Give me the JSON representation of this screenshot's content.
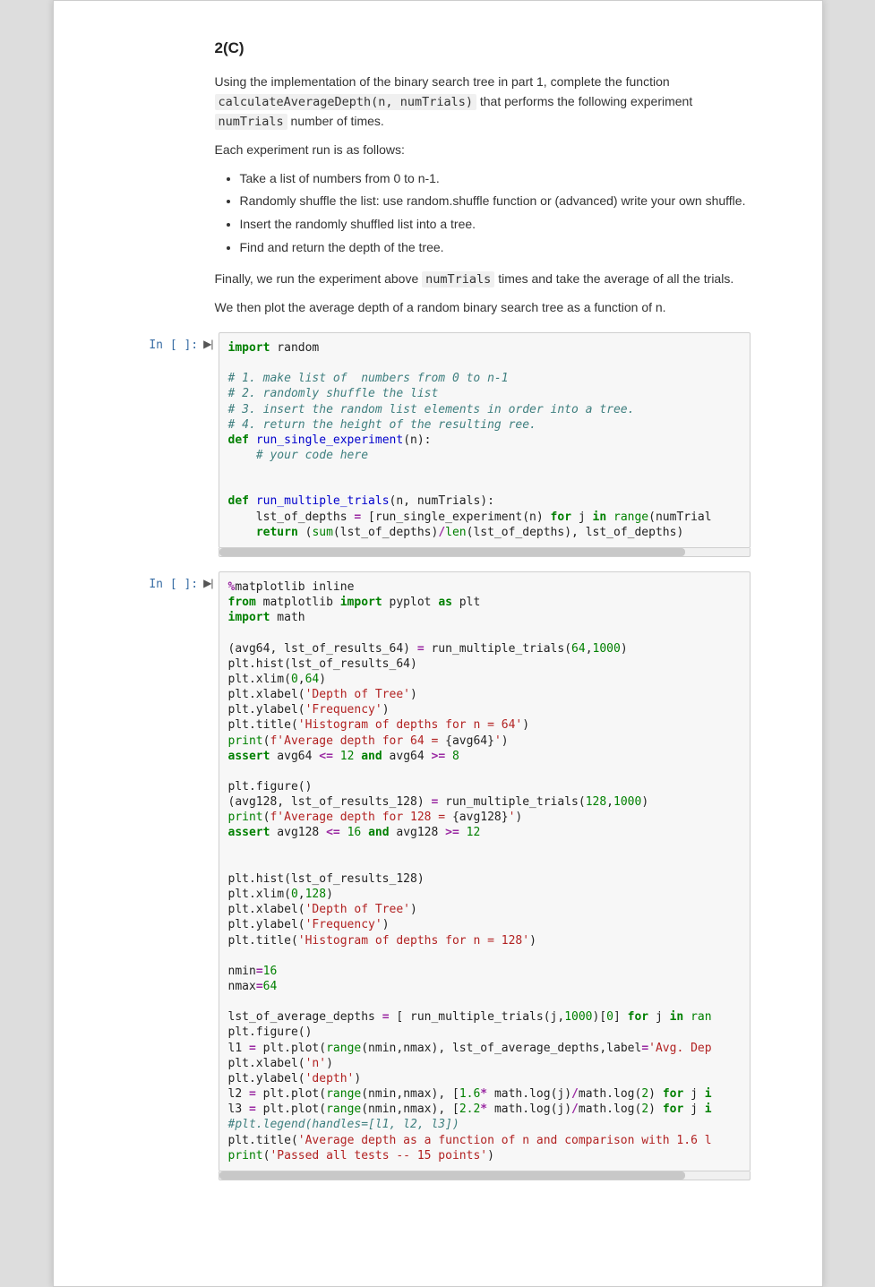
{
  "heading": "2(C)",
  "intro_p1_a": "Using the implementation of the binary search tree in part 1, complete the function ",
  "code_inline1": "calculateAverageDepth(n, numTrials)",
  "intro_p1_b": " that performs the following experiment ",
  "code_inline2": "numTrials",
  "intro_p1_c": " number of times.",
  "intro_p2": "Each experiment run is as follows:",
  "bullets": [
    "Take a list of numbers from 0 to n-1.",
    "Randomly shuffle the list: use random.shuffle function or (advanced) write your own shuffle.",
    "Insert the randomly shuffled list into a tree.",
    "Find and return the depth of the tree."
  ],
  "intro_p3_a": "Finally, we run the experiment above ",
  "code_inline3": "numTrials",
  "intro_p3_b": " times and take the average of all the trials.",
  "intro_p4": "We then plot the average depth of a random binary search tree as a function of n.",
  "prompt1": "In [ ]:",
  "prompt2": "In [ ]:",
  "code1": {
    "l1a": "import",
    "l1b": " random",
    "l2": "# 1. make list of  numbers from 0 to n-1",
    "l3": "# 2. randomly shuffle the list",
    "l4": "# 3. insert the random list elements in order into a tree.",
    "l5": "# 4. return the height of the resulting ree.",
    "l6a": "def",
    "l6b": " ",
    "l6c": "run_single_experiment",
    "l6d": "(n):",
    "l7": "    ",
    "l7b": "# your code here",
    "l8": "    ",
    "l9": "",
    "l10a": "def",
    "l10b": " ",
    "l10c": "run_multiple_trials",
    "l10d": "(n, numTrials):",
    "l11a": "    lst_of_depths ",
    "l11b": "=",
    "l11c": " [run_single_experiment(n) ",
    "l11d": "for",
    "l11e": " j ",
    "l11f": "in",
    "l11g": " ",
    "l11h": "range",
    "l11i": "(numTrial",
    "l12a": "    ",
    "l12b": "return",
    "l12c": " (",
    "l12d": "sum",
    "l12e": "(lst_of_depths)",
    "l12f": "/",
    "l12g": "len",
    "l12h": "(lst_of_depths), lst_of_depths)"
  },
  "code2": {
    "l1a": "%",
    "l1b": "matplotlib",
    "l1c": " inline",
    "l2a": "from",
    "l2b": " matplotlib ",
    "l2c": "import",
    "l2d": " pyplot ",
    "l2e": "as",
    "l2f": " plt",
    "l3a": "import",
    "l3b": " math",
    "l5a": "(avg64, lst_of_results_64) ",
    "l5b": "=",
    "l5c": " run_multiple_trials(",
    "l5d": "64",
    "l5e": ",",
    "l5f": "1000",
    "l5g": ")",
    "l6": "plt.hist(lst_of_results_64)",
    "l7a": "plt.xlim(",
    "l7b": "0",
    "l7c": ",",
    "l7d": "64",
    "l7e": ")",
    "l8a": "plt.xlabel(",
    "l8b": "'Depth of Tree'",
    "l8c": ")",
    "l9a": "plt.ylabel(",
    "l9b": "'Frequency'",
    "l9c": ")",
    "l10a": "plt.title(",
    "l10b": "'Histogram of depths for n = 64'",
    "l10c": ")",
    "l11a": "print",
    "l11b": "(",
    "l11c": "f'Average depth for 64 = ",
    "l11d": "{avg64}",
    "l11e": "'",
    "l11f": ")",
    "l12a": "assert",
    "l12b": " avg64 ",
    "l12c": "<=",
    "l12d": " ",
    "l12e": "12",
    "l12f": " ",
    "l12g": "and",
    "l12h": " avg64 ",
    "l12i": ">=",
    "l12j": " ",
    "l12k": "8",
    "l14": "plt.figure()",
    "l15a": "(avg128, lst_of_results_128) ",
    "l15b": "=",
    "l15c": " run_multiple_trials(",
    "l15d": "128",
    "l15e": ",",
    "l15f": "1000",
    "l15g": ")",
    "l16a": "print",
    "l16b": "(",
    "l16c": "f'Average depth for 128 = ",
    "l16d": "{avg128}",
    "l16e": "'",
    "l16f": ")",
    "l17a": "assert",
    "l17b": " avg128 ",
    "l17c": "<=",
    "l17d": " ",
    "l17e": "16",
    "l17f": " ",
    "l17g": "and",
    "l17h": " avg128 ",
    "l17i": ">=",
    "l17j": " ",
    "l17k": "12",
    "l19": "plt.hist(lst_of_results_128)",
    "l20a": "plt.xlim(",
    "l20b": "0",
    "l20c": ",",
    "l20d": "128",
    "l20e": ")",
    "l21a": "plt.xlabel(",
    "l21b": "'Depth of Tree'",
    "l21c": ")",
    "l22a": "plt.ylabel(",
    "l22b": "'Frequency'",
    "l22c": ")",
    "l23a": "plt.title(",
    "l23b": "'Histogram of depths for n = 128'",
    "l23c": ")",
    "l25a": "nmin",
    "l25b": "=",
    "l25c": "16",
    "l26a": "nmax",
    "l26b": "=",
    "l26c": "64",
    "l28a": "lst_of_average_depths ",
    "l28b": "=",
    "l28c": " [ run_multiple_trials(j,",
    "l28d": "1000",
    "l28e": ")[",
    "l28f": "0",
    "l28g": "] ",
    "l28h": "for",
    "l28i": " j ",
    "l28j": "in",
    "l28k": " ",
    "l28l": "ran",
    "l29": "plt.figure()",
    "l30a": "l1 ",
    "l30b": "=",
    "l30c": " plt.plot(",
    "l30d": "range",
    "l30e": "(nmin,nmax), lst_of_average_depths,label",
    "l30f": "=",
    "l30g": "'Avg. Dep",
    "l31a": "plt.xlabel(",
    "l31b": "'n'",
    "l31c": ")",
    "l32a": "plt.ylabel(",
    "l32b": "'depth'",
    "l32c": ")",
    "l33a": "l2 ",
    "l33b": "=",
    "l33c": " plt.plot(",
    "l33d": "range",
    "l33e": "(nmin,nmax), [",
    "l33f": "1.6",
    "l33g": "*",
    "l33h": " math.log(j)",
    "l33i": "/",
    "l33j": "math.log(",
    "l33k": "2",
    "l33l": ") ",
    "l33m": "for",
    "l33n": " j ",
    "l33o": "i",
    "l34a": "l3 ",
    "l34b": "=",
    "l34c": " plt.plot(",
    "l34d": "range",
    "l34e": "(nmin,nmax), [",
    "l34f": "2.2",
    "l34g": "*",
    "l34h": " math.log(j)",
    "l34i": "/",
    "l34j": "math.log(",
    "l34k": "2",
    "l34l": ") ",
    "l34m": "for",
    "l34n": " j ",
    "l34o": "i",
    "l35": "#plt.legend(handles=[l1, l2, l3])",
    "l36a": "plt.title(",
    "l36b": "'Average depth as a function of n and comparison with 1.6 l",
    "l37a": "print",
    "l37b": "(",
    "l37c": "'Passed all tests -- 15 points'",
    "l37d": ")"
  }
}
